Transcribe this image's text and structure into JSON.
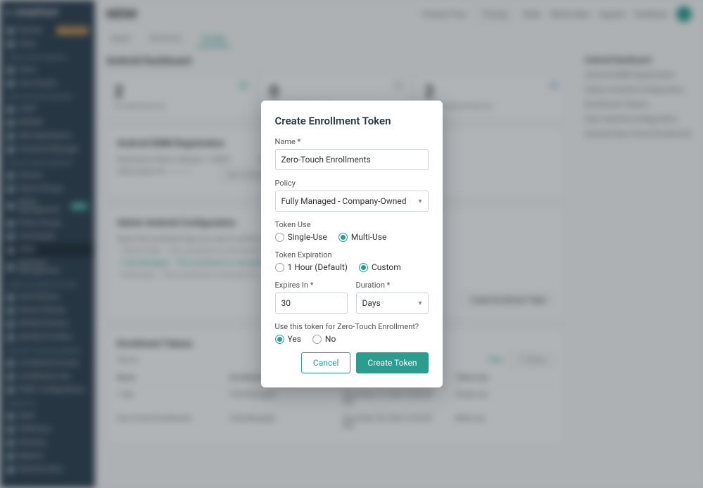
{
  "sidebar": {
    "brand": "JumpCloud",
    "groups": [
      {
        "head": "",
        "items": [
          {
            "label": "Devices",
            "badge": "UPGRADE"
          },
          {
            "label": "Users"
          }
        ]
      },
      {
        "head": "USER MANAGEMENT",
        "items": [
          {
            "label": "Users"
          },
          {
            "label": "User Groups"
          }
        ]
      },
      {
        "head": "DEVICE MANAGEMENT",
        "items": [
          {
            "label": "LDAP"
          },
          {
            "label": "RADIUS"
          },
          {
            "label": "SSO Applications"
          },
          {
            "label": "Password Manager"
          }
        ]
      },
      {
        "head": "DEVICE MANAGEMENT",
        "items": [
          {
            "label": "Devices"
          },
          {
            "label": "Device Groups"
          },
          {
            "label": "Policy Management",
            "badge_new": "NEW"
          },
          {
            "label": "Policy Groups"
          },
          {
            "label": "Commands"
          },
          {
            "label": "MDM",
            "active": true
          },
          {
            "label": "Software Management"
          }
        ]
      },
      {
        "head": "USER AUTHENTICATION",
        "items": [
          {
            "label": "Auth Policies"
          },
          {
            "label": "Device Policies"
          },
          {
            "label": "RADIUS Policies"
          },
          {
            "label": "Identity Providers"
          }
        ]
      },
      {
        "head": "SECURITY MANAGEMENT",
        "items": [
          {
            "label": "Conditional Access"
          },
          {
            "label": "Conditional Lists"
          },
          {
            "label": "SAML Configurations"
          }
        ]
      },
      {
        "head": "INSIGHTS",
        "items": [
          {
            "label": "SaaS"
          }
        ]
      },
      {
        "head": "",
        "items": [
          {
            "label": "SCIM Sync"
          },
          {
            "label": "Directory"
          },
          {
            "label": "Reports"
          },
          {
            "label": "Directory Sync"
          }
        ]
      }
    ]
  },
  "topbar": {
    "title": "MDM",
    "items": [
      "Product Tour",
      "Pricing",
      "Refer",
      "What's New",
      "Support",
      "Feedback"
    ]
  },
  "tabs": [
    "Apple",
    "Windows",
    "Google"
  ],
  "active_tab": "Google",
  "page": {
    "title": "Android Dashboard",
    "cards": [
      {
        "num": "2",
        "lbl": "Enrolled Devices",
        "color": "#cde9d8"
      },
      {
        "num": "0",
        "lbl": "Unenrolled Devices",
        "color": "#e5e5e5"
      },
      {
        "num": "2",
        "lbl": "Total Android Devices",
        "color": "#d6e4f0"
      }
    ],
    "sections": {
      "emm": {
        "title": "Android EMM Registration",
        "rows": [
          [
            "Registration Name:",
            "Mergers + EMEA"
          ],
          [
            "Subscription ID:",
            "------------"
          ]
        ],
        "rows2": [
          [
            "Unsubscribe:"
          ],
          [
            "Sync Enterprise",
            "Delete"
          ]
        ]
      },
      "config": {
        "title": "Admin Android Configuration",
        "desc": "Select the enrollment type you want to perform.",
        "opts": [
          "Work Profile – This enrollment is intended for…",
          "Fully Managed – This enrollment is intended for…",
          "Dedicated – This enrollment is intended for…"
        ],
        "btn": "Create Enrollment Token"
      },
      "tokens": {
        "title": "Enrollment Tokens",
        "filter": "Filter",
        "info": "2 Tokens",
        "cols": [
          "Name",
          "Enrollment Type",
          "Expiration",
          "Token Use"
        ],
        "rows": [
          [
            "1 day",
            "Fully Managed",
            "December 27, 2024 10:55:53 PM",
            "Single-use"
          ],
          [
            "Zero-Touch Enrollments",
            "Fully Managed",
            "December 28, 2024 10:55:53 PM",
            "Multi-use"
          ]
        ]
      }
    },
    "aside": {
      "head": "Android Dashboard",
      "items": [
        "Android EMM Registration",
        "Admin Android Configuration",
        "Enrollment Tokens",
        "User Android Configuration",
        "Android Zero-Touch Enrollment"
      ]
    }
  },
  "modal": {
    "title": "Create Enrollment Token",
    "name_label": "Name *",
    "name_value": "Zero-Touch Enrollments",
    "policy_label": "Policy",
    "policy_value": "Fully Managed - Company-Owned",
    "token_use_label": "Token Use",
    "token_use_opts": [
      "Single-Use",
      "Multi-Use"
    ],
    "token_use_selected": "Multi-Use",
    "expiration_label": "Token Expiration",
    "expiration_opts": [
      "1 Hour (Default)",
      "Custom"
    ],
    "expiration_selected": "Custom",
    "expires_in_label": "Expires In *",
    "expires_in_value": "30",
    "duration_label": "Duration *",
    "duration_value": "Days",
    "zt_label": "Use this token for Zero-Touch Enrollment?",
    "zt_opts": [
      "Yes",
      "No"
    ],
    "zt_selected": "Yes",
    "cancel": "Cancel",
    "create": "Create Token"
  }
}
